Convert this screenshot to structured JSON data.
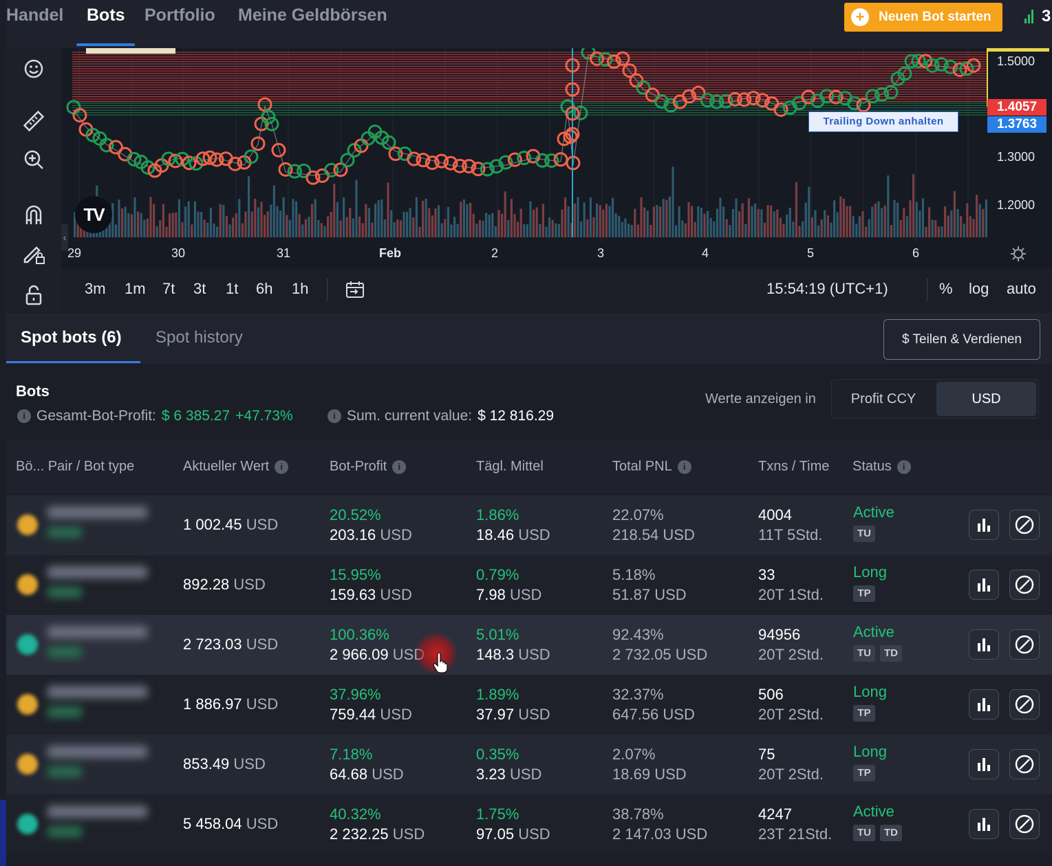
{
  "nav": {
    "items": [
      "Handel",
      "Bots",
      "Portfolio",
      "Meine Geldbörsen"
    ],
    "active": "Bots",
    "start_button": "Neuen Bot starten",
    "signal_count": "3"
  },
  "chart": {
    "price_axis": [
      "1.5000",
      "1.3000",
      "1.2000"
    ],
    "price_tags": {
      "red": "1.4057",
      "blue": "1.3763"
    },
    "x_labels": [
      "29",
      "30",
      "31",
      "Feb",
      "2",
      "3",
      "4",
      "5",
      "6"
    ],
    "trailing_label": "Trailing Down anhalten",
    "logo": "TV",
    "timeframes": [
      "3m",
      "1m",
      "7t",
      "3t",
      "1t",
      "6h",
      "1h"
    ],
    "time": "15:54:19 (UTC+1)",
    "options": [
      "%",
      "log",
      "auto"
    ],
    "colors": {
      "sell": "#f2634a",
      "buy": "#1f9d55",
      "line_red": "#e03a3a",
      "line_green": "#1f9d55"
    }
  },
  "tabs": {
    "spot_bots": "Spot bots (6)",
    "spot_history": "Spot history",
    "share": "$ Teilen & Verdienen"
  },
  "summary": {
    "title": "Bots",
    "profit_label": "Gesamt-Bot-Profit:",
    "profit_value": "$ 6 385.27",
    "profit_pct": "+47.73%",
    "sum_label": "Sum. current value:",
    "sum_value": "$ 12 816.29",
    "display_in": "Werte anzeigen in",
    "toggle": [
      "Profit CCY",
      "USD"
    ],
    "toggle_selected": "USD"
  },
  "table": {
    "headers": [
      "Bö... Pair / Bot type",
      "Aktueller Wert",
      "Bot-Profit",
      "Tägl. Mittel",
      "Total PNL",
      "Txns / Time",
      "Status"
    ],
    "rows": [
      {
        "coin_color": "#e3a72f",
        "value": "1 002.45",
        "unit": "USD",
        "profit_pct": "20.52%",
        "profit": "203.16",
        "daily_pct": "1.86%",
        "daily": "18.46",
        "pnl_pct": "22.07%",
        "pnl": "218.54",
        "txns": "4004",
        "time": "11T 5Std.",
        "status": "Active",
        "badges": [
          "TU"
        ]
      },
      {
        "coin_color": "#e3a72f",
        "value": "892.28",
        "unit": "USD",
        "profit_pct": "15.95%",
        "profit": "159.63",
        "daily_pct": "0.79%",
        "daily": "7.98",
        "pnl_pct": "5.18%",
        "pnl": "51.87",
        "txns": "33",
        "time": "20T 1Std.",
        "status": "Long",
        "badges": [
          "TP"
        ]
      },
      {
        "coin_color": "#1fb39a",
        "value": "2 723.03",
        "unit": "USD",
        "profit_pct": "100.36%",
        "profit": "2 966.09",
        "daily_pct": "5.01%",
        "daily": "148.3",
        "pnl_pct": "92.43%",
        "pnl": "2 732.05",
        "txns": "94956",
        "time": "20T 2Std.",
        "status": "Active",
        "badges": [
          "TU",
          "TD"
        ]
      },
      {
        "coin_color": "#e3a72f",
        "value": "1 886.97",
        "unit": "USD",
        "profit_pct": "37.96%",
        "profit": "759.44",
        "daily_pct": "1.89%",
        "daily": "37.97",
        "pnl_pct": "32.37%",
        "pnl": "647.56",
        "txns": "506",
        "time": "20T 2Std.",
        "status": "Long",
        "badges": [
          "TP"
        ]
      },
      {
        "coin_color": "#e3a72f",
        "value": "853.49",
        "unit": "USD",
        "profit_pct": "7.18%",
        "profit": "64.68",
        "daily_pct": "0.35%",
        "daily": "3.23",
        "pnl_pct": "2.07%",
        "pnl": "18.69",
        "txns": "75",
        "time": "20T 2Std.",
        "status": "Long",
        "badges": [
          "TP"
        ]
      },
      {
        "coin_color": "#1fb39a",
        "value": "5 458.04",
        "unit": "USD",
        "profit_pct": "40.32%",
        "profit": "2 232.25",
        "daily_pct": "1.75%",
        "daily": "97.05",
        "pnl_pct": "38.78%",
        "pnl": "2 147.03",
        "txns": "4247",
        "time": "23T 21Std.",
        "status": "Active",
        "badges": [
          "TU",
          "TD"
        ]
      }
    ]
  }
}
